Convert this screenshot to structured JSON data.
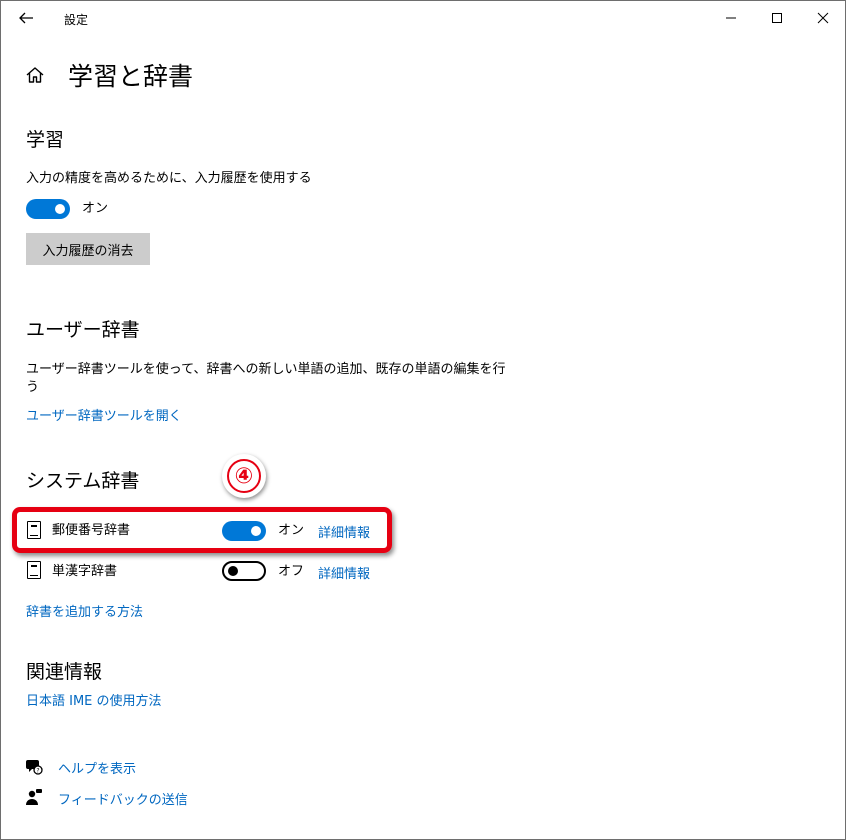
{
  "window": {
    "title": "設定",
    "icons": {
      "back": "back-arrow-icon",
      "minimize": "minimize-icon",
      "maximize": "maximize-icon",
      "close": "close-icon"
    }
  },
  "page": {
    "title": "学習と辞書",
    "home_icon": "home-icon"
  },
  "learning": {
    "heading": "学習",
    "description": "入力の精度を高めるために、入力履歴を使用する",
    "toggle_state": "オン",
    "clear_button": "入力履歴の消去"
  },
  "user_dict": {
    "heading": "ユーザー辞書",
    "description_line1": "ユーザー辞書ツールを使って、辞書への新しい単語の追加、既存の単語の編集を行",
    "description_line2": "う",
    "open_link": "ユーザー辞書ツールを開く"
  },
  "system_dict": {
    "heading": "システム辞書",
    "items": [
      {
        "name": "郵便番号辞書",
        "state": "オン",
        "on": true,
        "details": "詳細情報",
        "icon": "dictionary-icon"
      },
      {
        "name": "単漢字辞書",
        "state": "オフ",
        "on": false,
        "details": "詳細情報",
        "icon": "dictionary-icon"
      }
    ],
    "add_link": "辞書を追加する方法"
  },
  "related": {
    "heading": "関連情報",
    "ime_link": "日本語 IME の使用方法"
  },
  "footer": {
    "help": "ヘルプを表示",
    "feedback": "フィードバックの送信",
    "help_icon": "help-chat-icon",
    "feedback_icon": "feedback-person-icon"
  },
  "annotation": {
    "step": "④",
    "color": "#e60012"
  },
  "colors": {
    "accent": "#0078d7",
    "link": "#0067c0",
    "button_gray": "#cccccc"
  }
}
